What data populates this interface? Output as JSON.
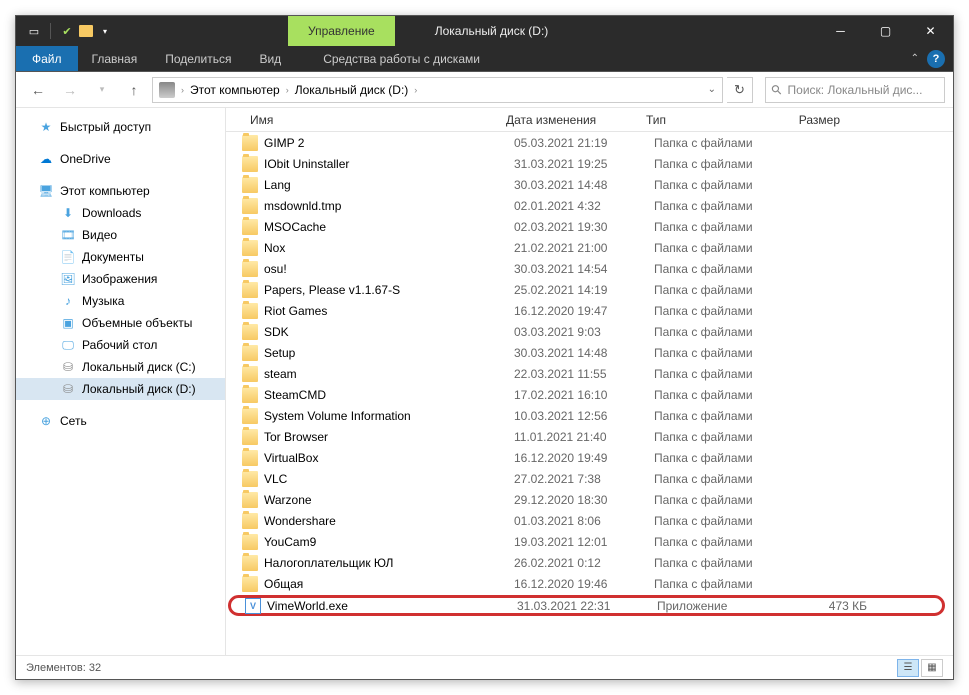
{
  "window": {
    "context_tab": "Управление",
    "title": "Локальный диск (D:)"
  },
  "ribbon": {
    "file": "Файл",
    "tabs": [
      "Главная",
      "Поделиться",
      "Вид"
    ],
    "context_tab": "Средства работы с дисками"
  },
  "nav": {
    "breadcrumb": [
      "Этот компьютер",
      "Локальный диск (D:)"
    ],
    "search_placeholder": "Поиск: Локальный дис..."
  },
  "sidebar": {
    "quick_access": "Быстрый доступ",
    "onedrive": "OneDrive",
    "this_pc": "Этот компьютер",
    "children": [
      {
        "icon": "download",
        "label": "Downloads"
      },
      {
        "icon": "video",
        "label": "Видео"
      },
      {
        "icon": "doc",
        "label": "Документы"
      },
      {
        "icon": "image",
        "label": "Изображения"
      },
      {
        "icon": "music",
        "label": "Музыка"
      },
      {
        "icon": "3d",
        "label": "Объемные объекты"
      },
      {
        "icon": "desktop",
        "label": "Рабочий стол"
      },
      {
        "icon": "disk",
        "label": "Локальный диск (C:)"
      },
      {
        "icon": "disk",
        "label": "Локальный диск (D:)",
        "selected": true
      }
    ],
    "network": "Сеть"
  },
  "columns": {
    "name": "Имя",
    "date": "Дата изменения",
    "type": "Тип",
    "size": "Размер"
  },
  "files": [
    {
      "name": "GIMP 2",
      "date": "05.03.2021 21:19",
      "type": "Папка с файлами",
      "size": "",
      "icon": "folder"
    },
    {
      "name": "IObit Uninstaller",
      "date": "31.03.2021 19:25",
      "type": "Папка с файлами",
      "size": "",
      "icon": "folder"
    },
    {
      "name": "Lang",
      "date": "30.03.2021 14:48",
      "type": "Папка с файлами",
      "size": "",
      "icon": "folder"
    },
    {
      "name": "msdownld.tmp",
      "date": "02.01.2021 4:32",
      "type": "Папка с файлами",
      "size": "",
      "icon": "folder"
    },
    {
      "name": "MSOCache",
      "date": "02.03.2021 19:30",
      "type": "Папка с файлами",
      "size": "",
      "icon": "folder"
    },
    {
      "name": "Nox",
      "date": "21.02.2021 21:00",
      "type": "Папка с файлами",
      "size": "",
      "icon": "folder"
    },
    {
      "name": "osu!",
      "date": "30.03.2021 14:54",
      "type": "Папка с файлами",
      "size": "",
      "icon": "folder"
    },
    {
      "name": "Papers, Please v1.1.67-S",
      "date": "25.02.2021 14:19",
      "type": "Папка с файлами",
      "size": "",
      "icon": "folder"
    },
    {
      "name": "Riot Games",
      "date": "16.12.2020 19:47",
      "type": "Папка с файлами",
      "size": "",
      "icon": "folder"
    },
    {
      "name": "SDK",
      "date": "03.03.2021 9:03",
      "type": "Папка с файлами",
      "size": "",
      "icon": "folder"
    },
    {
      "name": "Setup",
      "date": "30.03.2021 14:48",
      "type": "Папка с файлами",
      "size": "",
      "icon": "folder"
    },
    {
      "name": "steam",
      "date": "22.03.2021 11:55",
      "type": "Папка с файлами",
      "size": "",
      "icon": "folder"
    },
    {
      "name": "SteamCMD",
      "date": "17.02.2021 16:10",
      "type": "Папка с файлами",
      "size": "",
      "icon": "folder"
    },
    {
      "name": "System Volume Information",
      "date": "10.03.2021 12:56",
      "type": "Папка с файлами",
      "size": "",
      "icon": "folder"
    },
    {
      "name": "Tor Browser",
      "date": "11.01.2021 21:40",
      "type": "Папка с файлами",
      "size": "",
      "icon": "folder"
    },
    {
      "name": "VirtualBox",
      "date": "16.12.2020 19:49",
      "type": "Папка с файлами",
      "size": "",
      "icon": "folder"
    },
    {
      "name": "VLC",
      "date": "27.02.2021 7:38",
      "type": "Папка с файлами",
      "size": "",
      "icon": "folder"
    },
    {
      "name": "Warzone",
      "date": "29.12.2020 18:30",
      "type": "Папка с файлами",
      "size": "",
      "icon": "folder"
    },
    {
      "name": "Wondershare",
      "date": "01.03.2021 8:06",
      "type": "Папка с файлами",
      "size": "",
      "icon": "folder"
    },
    {
      "name": "YouCam9",
      "date": "19.03.2021 12:01",
      "type": "Папка с файлами",
      "size": "",
      "icon": "folder"
    },
    {
      "name": "Налогоплательщик ЮЛ",
      "date": "26.02.2021 0:12",
      "type": "Папка с файлами",
      "size": "",
      "icon": "folder"
    },
    {
      "name": "Общая",
      "date": "16.12.2020 19:46",
      "type": "Папка с файлами",
      "size": "",
      "icon": "folder"
    },
    {
      "name": "VimeWorld.exe",
      "date": "31.03.2021 22:31",
      "type": "Приложение",
      "size": "473 КБ",
      "icon": "exe",
      "highlighted": true
    }
  ],
  "status": {
    "count_label": "Элементов: 32"
  }
}
